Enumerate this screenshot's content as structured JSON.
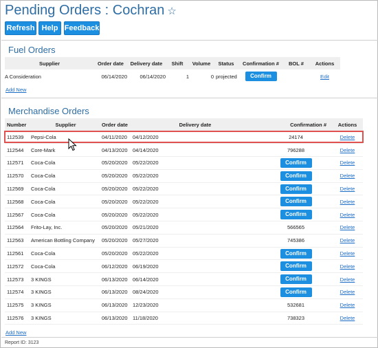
{
  "header": {
    "title": "Pending Orders : Cochran",
    "star": "☆"
  },
  "toolbar": {
    "refresh_label": "Refresh",
    "help_label": "Help",
    "feedback_label": "Feedback"
  },
  "fuel": {
    "title": "Fuel Orders",
    "columns": [
      "Supplier",
      "Order date",
      "Delivery date",
      "Shift",
      "Volume",
      "Status",
      "Confirmation #",
      "BOL #",
      "Actions"
    ],
    "rows": [
      {
        "supplier": "A Consideration",
        "order_date": "06/14/2020",
        "delivery_date": "06/14/2020",
        "shift": "1",
        "volume": "0",
        "status": "projected",
        "confirmation": "Confirm",
        "bol": "",
        "action": "Edit"
      }
    ],
    "add_new": "Add New"
  },
  "merch": {
    "title": "Merchandise Orders",
    "columns": [
      "Number",
      "Supplier",
      "Order date",
      "Delivery date",
      "Confirmation #",
      "Actions"
    ],
    "confirm_label": "Confirm",
    "delete_label": "Delete",
    "rows": [
      {
        "number": "112539",
        "supplier": "Pepsi-Cola",
        "order_date": "04/11/2020",
        "delivery_date": "04/12/2020",
        "confirmation": "24174"
      },
      {
        "number": "112544",
        "supplier": "Core-Mark",
        "order_date": "04/13/2020",
        "delivery_date": "04/14/2020",
        "confirmation": "796288"
      },
      {
        "number": "112571",
        "supplier": "Coca-Cola",
        "order_date": "05/20/2020",
        "delivery_date": "05/22/2020",
        "confirmation": ""
      },
      {
        "number": "112570",
        "supplier": "Coca-Cola",
        "order_date": "05/20/2020",
        "delivery_date": "05/22/2020",
        "confirmation": ""
      },
      {
        "number": "112569",
        "supplier": "Coca-Cola",
        "order_date": "05/20/2020",
        "delivery_date": "05/22/2020",
        "confirmation": ""
      },
      {
        "number": "112568",
        "supplier": "Coca-Cola",
        "order_date": "05/20/2020",
        "delivery_date": "05/22/2020",
        "confirmation": ""
      },
      {
        "number": "112567",
        "supplier": "Coca-Cola",
        "order_date": "05/20/2020",
        "delivery_date": "05/22/2020",
        "confirmation": ""
      },
      {
        "number": "112564",
        "supplier": "Frito-Lay, Inc.",
        "order_date": "05/20/2020",
        "delivery_date": "05/21/2020",
        "confirmation": "566565"
      },
      {
        "number": "112563",
        "supplier": "American Bottling Company",
        "order_date": "05/20/2020",
        "delivery_date": "05/27/2020",
        "confirmation": "745386"
      },
      {
        "number": "112561",
        "supplier": "Coca-Cola",
        "order_date": "05/20/2020",
        "delivery_date": "05/22/2020",
        "confirmation": ""
      },
      {
        "number": "112572",
        "supplier": "Coca-Cola",
        "order_date": "06/12/2020",
        "delivery_date": "06/19/2020",
        "confirmation": ""
      },
      {
        "number": "112573",
        "supplier": "3 KINGS",
        "order_date": "06/13/2020",
        "delivery_date": "06/14/2020",
        "confirmation": ""
      },
      {
        "number": "112574",
        "supplier": "3 KINGS",
        "order_date": "06/13/2020",
        "delivery_date": "08/24/2020",
        "confirmation": ""
      },
      {
        "number": "112575",
        "supplier": "3 KINGS",
        "order_date": "06/13/2020",
        "delivery_date": "12/23/2020",
        "confirmation": "532681"
      },
      {
        "number": "112576",
        "supplier": "3 KINGS",
        "order_date": "06/13/2020",
        "delivery_date": "11/18/2020",
        "confirmation": "738323"
      }
    ],
    "add_new": "Add New"
  },
  "footer": {
    "report_id": "Report ID: 3123"
  },
  "colors": {
    "accent": "#1d8fe0",
    "title": "#2e6da4",
    "highlight": "#e0504f"
  }
}
